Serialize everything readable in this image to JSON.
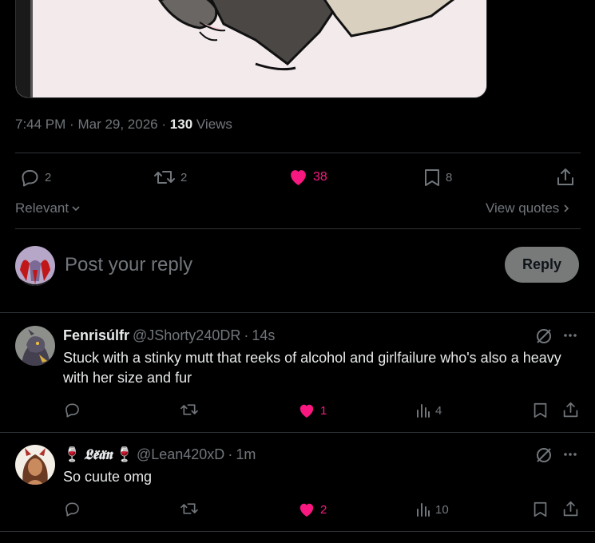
{
  "post": {
    "time": "7:44 PM",
    "date": "Mar 29, 2026",
    "sep": "·",
    "views_count": "130",
    "views_label": "Views",
    "actions": {
      "replies": "2",
      "reposts": "2",
      "likes": "38",
      "bookmarks": "8"
    }
  },
  "filters": {
    "sort_label": "Relevant",
    "quotes_label": "View quotes"
  },
  "composer": {
    "placeholder": "Post your reply",
    "button_label": "Reply"
  },
  "replies": [
    {
      "name": "Fenrisúlfr",
      "handle": "@JShorty240DR",
      "sep": "·",
      "time": "14s",
      "text": "Stuck with a stinky mutt that reeks of alcohol and girlfailure who's also a heavy with her size and fur",
      "likes": "1",
      "views": "4"
    },
    {
      "name_prefix": "🍷",
      "name": "𝕷𝖊̈𝖆̈𝖓",
      "name_suffix": "🍷",
      "handle": "@Lean420xD",
      "sep": "·",
      "time": "1m",
      "text": "So cuute omg",
      "likes": "2",
      "views": "10"
    }
  ],
  "colors": {
    "background": "#000000",
    "text": "#e7e9ea",
    "muted": "#71767b",
    "like": "#f91880",
    "divider": "#2f3336",
    "reply_button": "#787a7a"
  }
}
